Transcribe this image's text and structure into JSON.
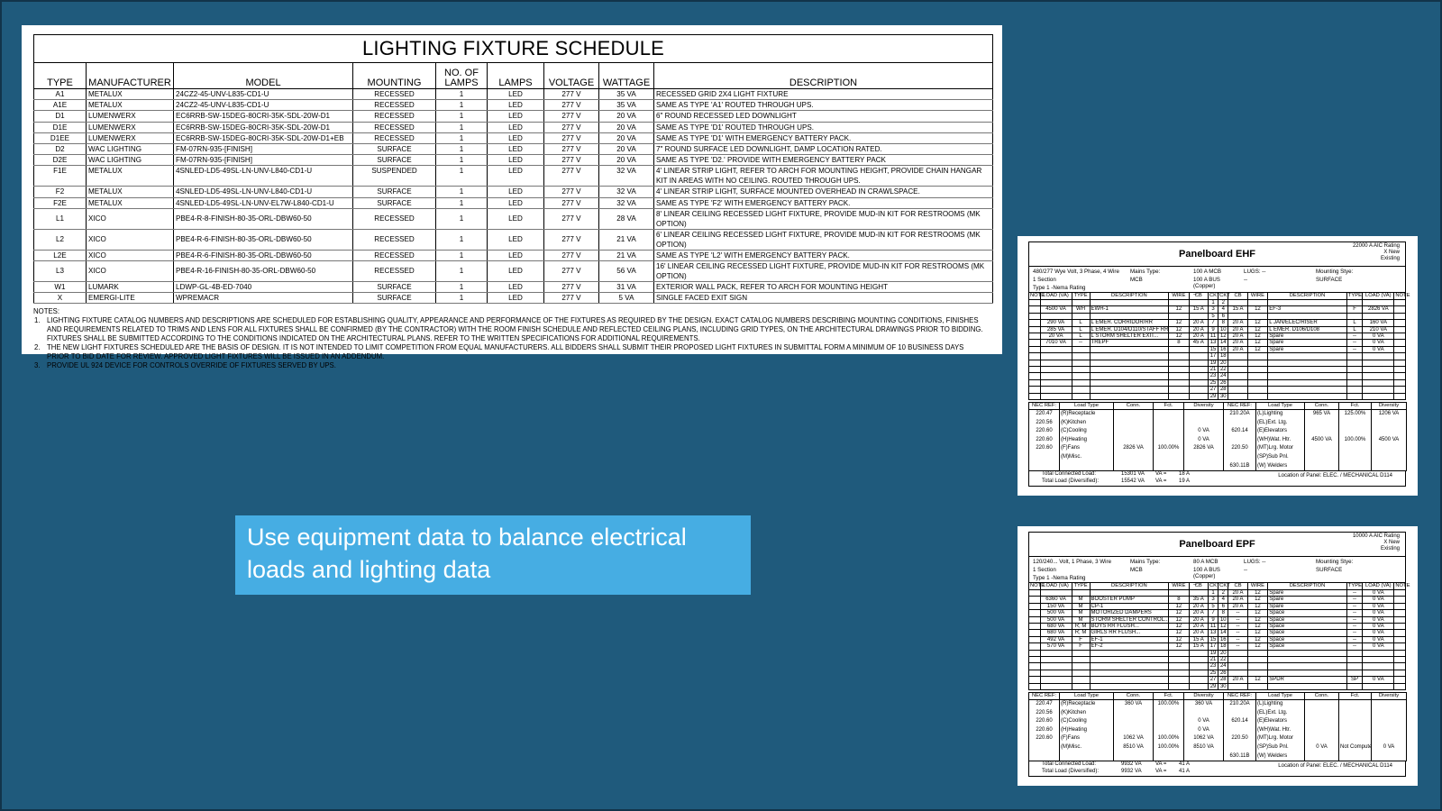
{
  "lighting_schedule": {
    "title": "LIGHTING FIXTURE SCHEDULE",
    "columns": [
      "TYPE",
      "MANUFACTURER",
      "MODEL",
      "MOUNTING",
      "NO. OF LAMPS",
      "LAMPS",
      "VOLTAGE",
      "WATTAGE",
      "DESCRIPTION"
    ],
    "rows": [
      [
        "A1",
        "METALUX",
        "24CZ2-45-UNV-L835-CD1-U",
        "RECESSED",
        "1",
        "LED",
        "277 V",
        "35 VA",
        "RECESSED GRID 2X4 LIGHT FIXTURE"
      ],
      [
        "A1E",
        "METALUX",
        "24CZ2-45-UNV-L835-CD1-U",
        "RECESSED",
        "1",
        "LED",
        "277 V",
        "35 VA",
        "SAME AS TYPE 'A1' ROUTED THROUGH UPS."
      ],
      [
        "D1",
        "LUMENWERX",
        "EC6RRB-SW-15DEG-80CRI-35K-SDL-20W-D1",
        "RECESSED",
        "1",
        "LED",
        "277 V",
        "20 VA",
        "6\" ROUND RECESSED LED DOWNLIGHT"
      ],
      [
        "D1E",
        "LUMENWERX",
        "EC6RRB-SW-15DEG-80CRI-35K-SDL-20W-D1",
        "RECESSED",
        "1",
        "LED",
        "277 V",
        "20 VA",
        "SAME AS TYPE 'D1' ROUTED THROUGH UPS."
      ],
      [
        "D1EE",
        "LUMENWERX",
        "EC6RRB-SW-15DEG-80CRI-35K-SDL-20W-D1+EB",
        "RECESSED",
        "1",
        "LED",
        "277 V",
        "20 VA",
        "SAME AS TYPE 'D1' WITH EMERGENCY BATTERY PACK."
      ],
      [
        "D2",
        "WAC LIGHTING",
        "FM-07RN-935-[FINISH]",
        "SURFACE",
        "1",
        "LED",
        "277 V",
        "20 VA",
        "7\" ROUND SURFACE LED DOWNLIGHT, DAMP LOCATION RATED."
      ],
      [
        "D2E",
        "WAC LIGHTING",
        "FM-07RN-935-[FINISH]",
        "SURFACE",
        "1",
        "LED",
        "277 V",
        "20 VA",
        "SAME AS TYPE 'D2.' PROVIDE WITH EMERGENCY BATTERY PACK"
      ],
      [
        "F1E",
        "METALUX",
        "4SNLED-LD5-49SL-LN-UNV-L840-CD1-U",
        "SUSPENDED",
        "1",
        "LED",
        "277 V",
        "32 VA",
        "4' LINEAR STRIP LIGHT, REFER TO ARCH FOR MOUNTING HEIGHT, PROVIDE CHAIN HANGAR KIT IN AREAS WITH NO CEILING. ROUTED THROUGH UPS."
      ],
      [
        "F2",
        "METALUX",
        "4SNLED-LD5-49SL-LN-UNV-L840-CD1-U",
        "SURFACE",
        "1",
        "LED",
        "277 V",
        "32 VA",
        "4' LINEAR STRIP LIGHT, SURFACE MOUNTED OVERHEAD IN CRAWLSPACE."
      ],
      [
        "F2E",
        "METALUX",
        "4SNLED-LD5-49SL-LN-UNV-EL7W-L840-CD1-U",
        "SURFACE",
        "1",
        "LED",
        "277 V",
        "32 VA",
        "SAME AS TYPE 'F2' WITH EMERGENCY BATTERY PACK."
      ],
      [
        "L1",
        "XICO",
        "PBE4-R-8-FINISH-80-35-ORL-DBW60-50",
        "RECESSED",
        "1",
        "LED",
        "277 V",
        "28 VA",
        "8' LINEAR CEILING RECESSED LIGHT FIXTURE, PROVIDE MUD-IN KIT FOR RESTROOMS (MK OPTION)"
      ],
      [
        "L2",
        "XICO",
        "PBE4-R-6-FINISH-80-35-ORL-DBW60-50",
        "RECESSED",
        "1",
        "LED",
        "277 V",
        "21 VA",
        "6' LINEAR CEILING RECESSED LIGHT FIXTURE, PROVIDE MUD-IN KIT FOR RESTROOMS (MK OPTION)"
      ],
      [
        "L2E",
        "XICO",
        "PBE4-R-6-FINISH-80-35-ORL-DBW60-50",
        "RECESSED",
        "1",
        "LED",
        "277 V",
        "21 VA",
        "SAME AS TYPE 'L2' WITH EMERGENCY BATTERY PACK."
      ],
      [
        "L3",
        "XICO",
        "PBE4-R-16-FINISH-80-35-ORL-DBW60-50",
        "RECESSED",
        "1",
        "LED",
        "277 V",
        "56 VA",
        "16' LINEAR CEILING RECESSED LIGHT FIXTURE, PROVIDE MUD-IN KIT FOR RESTROOMS (MK OPTION)"
      ],
      [
        "W1",
        "LUMARK",
        "LDWP-GL-4B-ED-7040",
        "SURFACE",
        "1",
        "LED",
        "277 V",
        "31 VA",
        "EXTERIOR WALL PACK, REFER TO ARCH FOR MOUNTING HEIGHT"
      ],
      [
        "X",
        "EMERGI-LITE",
        "WPREMACR",
        "SURFACE",
        "1",
        "LED",
        "277 V",
        "5 VA",
        "SINGLE FACED EXIT SIGN"
      ]
    ],
    "notes_label": "NOTES:",
    "notes": [
      {
        "num": "1.",
        "text": "LIGHTING FIXTURE CATALOG NUMBERS AND DESCRIPTIONS ARE SCHEDULED FOR ESTABLISHING QUALITY, APPEARANCE AND PERFORMANCE OF THE FIXTURES AS REQUIRED BY THE DESIGN. EXACT CATALOG NUMBERS DESCRIBING MOUNTING CONDITIONS, FINISHES AND REQUIREMENTS RELATED TO TRIMS AND LENS FOR ALL FIXTURES SHALL BE CONFIRMED (BY THE CONTRACTOR) WITH THE ROOM FINISH SCHEDULE AND REFLECTED CEILING PLANS, INCLUDING GRID TYPES, ON THE ARCHITECTURAL DRAWINGS PRIOR TO BIDDING. FIXTURES SHALL BE SUBMITTED ACCORDING TO THE CONDITIONS INDICATED ON THE ARCHITECTURAL PLANS. REFER TO THE WRITTEN SPECIFICATIONS FOR ADDITIONAL REQUIREMENTS."
      },
      {
        "num": "2.",
        "text": "THE NEW LIGHT FIXTURES SCHEDULED ARE THE BASIS OF DESIGN. IT IS NOT INTENDED TO LIMIT COMPETITION FROM EQUAL MANUFACTURERS. ALL BIDDERS SHALL SUBMIT THEIR PROPOSED LIGHT FIXTURES IN SUBMITTAL FORM A MINIMUM OF 10 BUSINESS DAYS PRIOR TO BID DATE FOR REVIEW. APPROVED LIGHT FIXTURES WILL BE ISSUED IN AN ADDENDUM."
      },
      {
        "num": "3.",
        "text": "PROVIDE UL 924 DEVICE FOR CONTROLS OVERRIDE OF FIXTURES SERVED BY UPS."
      }
    ]
  },
  "callout": {
    "line1": "Use equipment data to balance electrical",
    "line2": "loads and lighting data"
  },
  "panels": [
    {
      "title": "Panelboard EHF",
      "aic": [
        "22000 A  AIC Rating",
        "X  New",
        "Existing"
      ],
      "info": [
        "480/277 Wye  Volt, 3  Phase,  4  Wire",
        "1  Section",
        "Type 1 -Nema Rating",
        "Mains Type:",
        "MCB",
        "100 A  MCB",
        "100 A  BUS (Copper)",
        "--",
        "LUGS:  --",
        "--",
        "Mounting Stye:",
        "SURFACE"
      ],
      "headers": [
        "NOTE",
        "LOAD (VA)",
        "TYPE",
        "DESCRIPTION",
        "WIRE",
        "CB",
        "CKT",
        "CKT",
        "CB",
        "WIRE",
        "DESCRIPTION",
        "TYPE",
        "LOAD (VA)",
        "NOTE"
      ],
      "circuits": [
        [
          "",
          "",
          "",
          "",
          "",
          "",
          "1",
          "2",
          "",
          "",
          "",
          "",
          "",
          ""
        ],
        [
          "",
          "4500 VA",
          "WH",
          "EWH-1",
          "12",
          "15 A",
          "3",
          "4",
          "15 A",
          "12",
          "EF-3",
          "F",
          "2826 VA",
          ""
        ],
        [
          "",
          "",
          "",
          "",
          "",
          "",
          "5",
          "6",
          "",
          "",
          "",
          "",
          "",
          ""
        ],
        [
          "",
          "290 VA",
          "L",
          "L EMER. CORRIDOR/RR",
          "12",
          "20 A",
          "7",
          "8",
          "20 A",
          "12",
          "L JAN/ELEC/RISER",
          "L",
          "160 VA",
          ""
        ],
        [
          "",
          "285 VA",
          "L",
          "L EMER. D104/D110/STAFF RR",
          "12",
          "20 A",
          "9",
          "10",
          "20 A",
          "12",
          "L EMER. D106/D108",
          "L",
          "210 VA",
          ""
        ],
        [
          "",
          "20 VA",
          "L",
          "L STORM SHELTER EXIT...",
          "12",
          "20 A",
          "11",
          "12",
          "20 A",
          "12",
          "Spare",
          "--",
          "0 VA",
          ""
        ],
        [
          "",
          "7010 VA",
          "--",
          "TREPF",
          "8",
          "45 A",
          "13",
          "14",
          "20 A",
          "12",
          "Spare",
          "--",
          "0 VA",
          ""
        ],
        [
          "",
          "",
          "",
          "",
          "",
          "",
          "15",
          "16",
          "20 A",
          "12",
          "Spare",
          "--",
          "0 VA",
          ""
        ],
        [
          "",
          "",
          "",
          "",
          "",
          "",
          "17",
          "18",
          "",
          "",
          "",
          "",
          "",
          ""
        ],
        [
          "",
          "",
          "",
          "",
          "",
          "",
          "19",
          "20",
          "",
          "",
          "",
          "",
          "",
          ""
        ],
        [
          "",
          "",
          "",
          "",
          "",
          "",
          "21",
          "22",
          "",
          "",
          "",
          "",
          "",
          ""
        ],
        [
          "",
          "",
          "",
          "",
          "",
          "",
          "23",
          "24",
          "",
          "",
          "",
          "",
          "",
          ""
        ],
        [
          "",
          "",
          "",
          "",
          "",
          "",
          "25",
          "26",
          "",
          "",
          "",
          "",
          "",
          ""
        ],
        [
          "",
          "",
          "",
          "",
          "",
          "",
          "27",
          "28",
          "",
          "",
          "",
          "",
          "",
          ""
        ],
        [
          "",
          "",
          "",
          "",
          "",
          "",
          "29",
          "30",
          "",
          "",
          "",
          "",
          "",
          ""
        ]
      ],
      "summary_headers": [
        "NEC REF:",
        "Load Type",
        "Conn.",
        "Fct.",
        "Diversity",
        "NEC REF:",
        "Load Type",
        "Conn.",
        "Fct.",
        "Diversity"
      ],
      "summary": [
        [
          "220.47",
          "(R)Receptacle",
          "",
          "",
          "",
          "210.20A",
          "(L)Lighting",
          "965 VA",
          "125.00%",
          "1206 VA"
        ],
        [
          "220.56",
          "(K)Kitchen",
          "",
          "",
          "",
          "",
          "(EL)Ext. Ltg.",
          "",
          "",
          ""
        ],
        [
          "220.60",
          "(C)Cooling",
          "",
          "",
          "0 VA",
          "620.14",
          "(E)Elevators",
          "",
          "",
          ""
        ],
        [
          "220.60",
          "(H)Heating",
          "",
          "",
          "0 VA",
          "",
          "(WH)Wat. Htr.",
          "4500 VA",
          "100.00%",
          "4500 VA"
        ],
        [
          "220.60",
          "(F)Fans",
          "2826 VA",
          "100.00%",
          "2826 VA",
          "220.50",
          "(MT)Lrg. Motor",
          "",
          "",
          ""
        ],
        [
          "",
          "(M)Misc.",
          "",
          "",
          "",
          "",
          "(SP)Sub Pnl.",
          "",
          "",
          ""
        ],
        [
          "",
          "",
          "",
          "",
          "",
          "630.11B",
          "(W) Welders",
          "",
          "",
          ""
        ]
      ],
      "totals": [
        "Total Connected Load:",
        "15301 VA",
        "VA  =",
        "18 A",
        "Total Load (Diversified):",
        "15542 VA",
        "VA  =",
        "19 A"
      ],
      "location": "Location of Panel:  ELEC. / MECHANICAL D114"
    },
    {
      "title": "Panelboard EPF",
      "aic": [
        "10000 A  AIC Rating",
        "X  New",
        "Existing"
      ],
      "info": [
        "120/240...  Volt, 1  Phase,  3  Wire",
        "1  Section",
        "Type 1 -Nema Rating",
        "Mains Type:",
        "MCB",
        "80 A  MCB",
        "100 A  BUS (Copper)",
        "--",
        "LUGS:  --",
        "--",
        "Mounting Stye:",
        "SURFACE"
      ],
      "headers": [
        "NOTE",
        "LOAD (VA)",
        "TYPE",
        "DESCRIPTION",
        "WIRE",
        "CB",
        "CKT",
        "CKT",
        "CB",
        "WIRE",
        "DESCRIPTION",
        "TYPE",
        "LOAD (VA)",
        "NOTE"
      ],
      "circuits": [
        [
          "",
          "",
          "",
          "",
          "",
          "",
          "1",
          "2",
          "20 A",
          "12",
          "Spare",
          "--",
          "0 VA",
          ""
        ],
        [
          "",
          "6360 VA",
          "M",
          "BOOSTER PUMP",
          "8",
          "35 A",
          "3",
          "4",
          "20 A",
          "12",
          "Spare",
          "--",
          "0 VA",
          ""
        ],
        [
          "",
          "150 VA",
          "M",
          "CP-1",
          "12",
          "20 A",
          "5",
          "6",
          "20 A",
          "12",
          "Spare",
          "--",
          "0 VA",
          ""
        ],
        [
          "",
          "500 VA",
          "M",
          "MOTORIZED DAMPERS",
          "12",
          "20 A",
          "7",
          "8",
          "--",
          "12",
          "Space",
          "--",
          "0 VA",
          ""
        ],
        [
          "",
          "500 VA",
          "M",
          "STORM SHELTER CONTROL...",
          "12",
          "20 A",
          "9",
          "10",
          "--",
          "12",
          "Space",
          "--",
          "0 VA",
          ""
        ],
        [
          "",
          "680 VA",
          "R; M",
          "BOYS RR FLUSH...",
          "12",
          "20 A",
          "11",
          "12",
          "--",
          "12",
          "Space",
          "--",
          "0 VA",
          ""
        ],
        [
          "",
          "680 VA",
          "R; M",
          "GIRLS RR FLUSH...",
          "12",
          "20 A",
          "13",
          "14",
          "--",
          "12",
          "Space",
          "--",
          "0 VA",
          ""
        ],
        [
          "",
          "492 VA",
          "F",
          "EF-1",
          "12",
          "15 A",
          "15",
          "16",
          "--",
          "12",
          "Space",
          "--",
          "0 VA",
          ""
        ],
        [
          "",
          "570 VA",
          "F",
          "EF-2",
          "12",
          "15 A",
          "17",
          "18",
          "--",
          "12",
          "Space",
          "--",
          "0 VA",
          ""
        ],
        [
          "",
          "",
          "",
          "",
          "",
          "",
          "19",
          "20",
          "",
          "",
          "",
          "",
          "",
          ""
        ],
        [
          "",
          "",
          "",
          "",
          "",
          "",
          "21",
          "22",
          "",
          "",
          "",
          "",
          "",
          ""
        ],
        [
          "",
          "",
          "",
          "",
          "",
          "",
          "23",
          "24",
          "",
          "",
          "",
          "",
          "",
          ""
        ],
        [
          "",
          "",
          "",
          "",
          "",
          "",
          "25",
          "26",
          "",
          "",
          "",
          "",
          "",
          ""
        ],
        [
          "",
          "",
          "",
          "",
          "",
          "",
          "27",
          "28",
          "20 A",
          "12",
          "SPDR",
          "SP",
          "0 VA",
          ""
        ],
        [
          "",
          "",
          "",
          "",
          "",
          "",
          "29",
          "30",
          "",
          "",
          "",
          "",
          "",
          ""
        ]
      ],
      "summary_headers": [
        "NEC REF:",
        "Load Type",
        "Conn.",
        "Fct.",
        "Diversity",
        "NEC REF:",
        "Load Type",
        "Conn.",
        "Fct.",
        "Diversity"
      ],
      "summary": [
        [
          "220.47",
          "(R)Receptacle",
          "360 VA",
          "100.00%",
          "360 VA",
          "210.20A",
          "(L)Lighting",
          "",
          "",
          ""
        ],
        [
          "220.56",
          "(K)Kitchen",
          "",
          "",
          "",
          "",
          "(EL)Ext. Ltg.",
          "",
          "",
          ""
        ],
        [
          "220.60",
          "(C)Cooling",
          "",
          "",
          "0 VA",
          "620.14",
          "(E)Elevators",
          "",
          "",
          ""
        ],
        [
          "220.60",
          "(H)Heating",
          "",
          "",
          "0 VA",
          "",
          "(WH)Wat. Htr.",
          "",
          "",
          ""
        ],
        [
          "220.60",
          "(F)Fans",
          "1062 VA",
          "100.00%",
          "1062 VA",
          "220.50",
          "(MT)Lrg. Motor",
          "",
          "",
          ""
        ],
        [
          "",
          "(M)Misc.",
          "8510 VA",
          "100.00%",
          "8510 VA",
          "",
          "(SP)Sub Pnl.",
          "0 VA",
          "Not Computed",
          "0 VA"
        ],
        [
          "",
          "",
          "",
          "",
          "",
          "630.11B",
          "(W) Welders",
          "",
          "",
          ""
        ]
      ],
      "totals": [
        "Total Connected Load:",
        "9932 VA",
        "VA  =",
        "41 A",
        "Total Load (Diversified):",
        "9932 VA",
        "VA  =",
        "41 A"
      ],
      "location": "Location of Panel:  ELEC. / MECHANICAL D114"
    }
  ]
}
